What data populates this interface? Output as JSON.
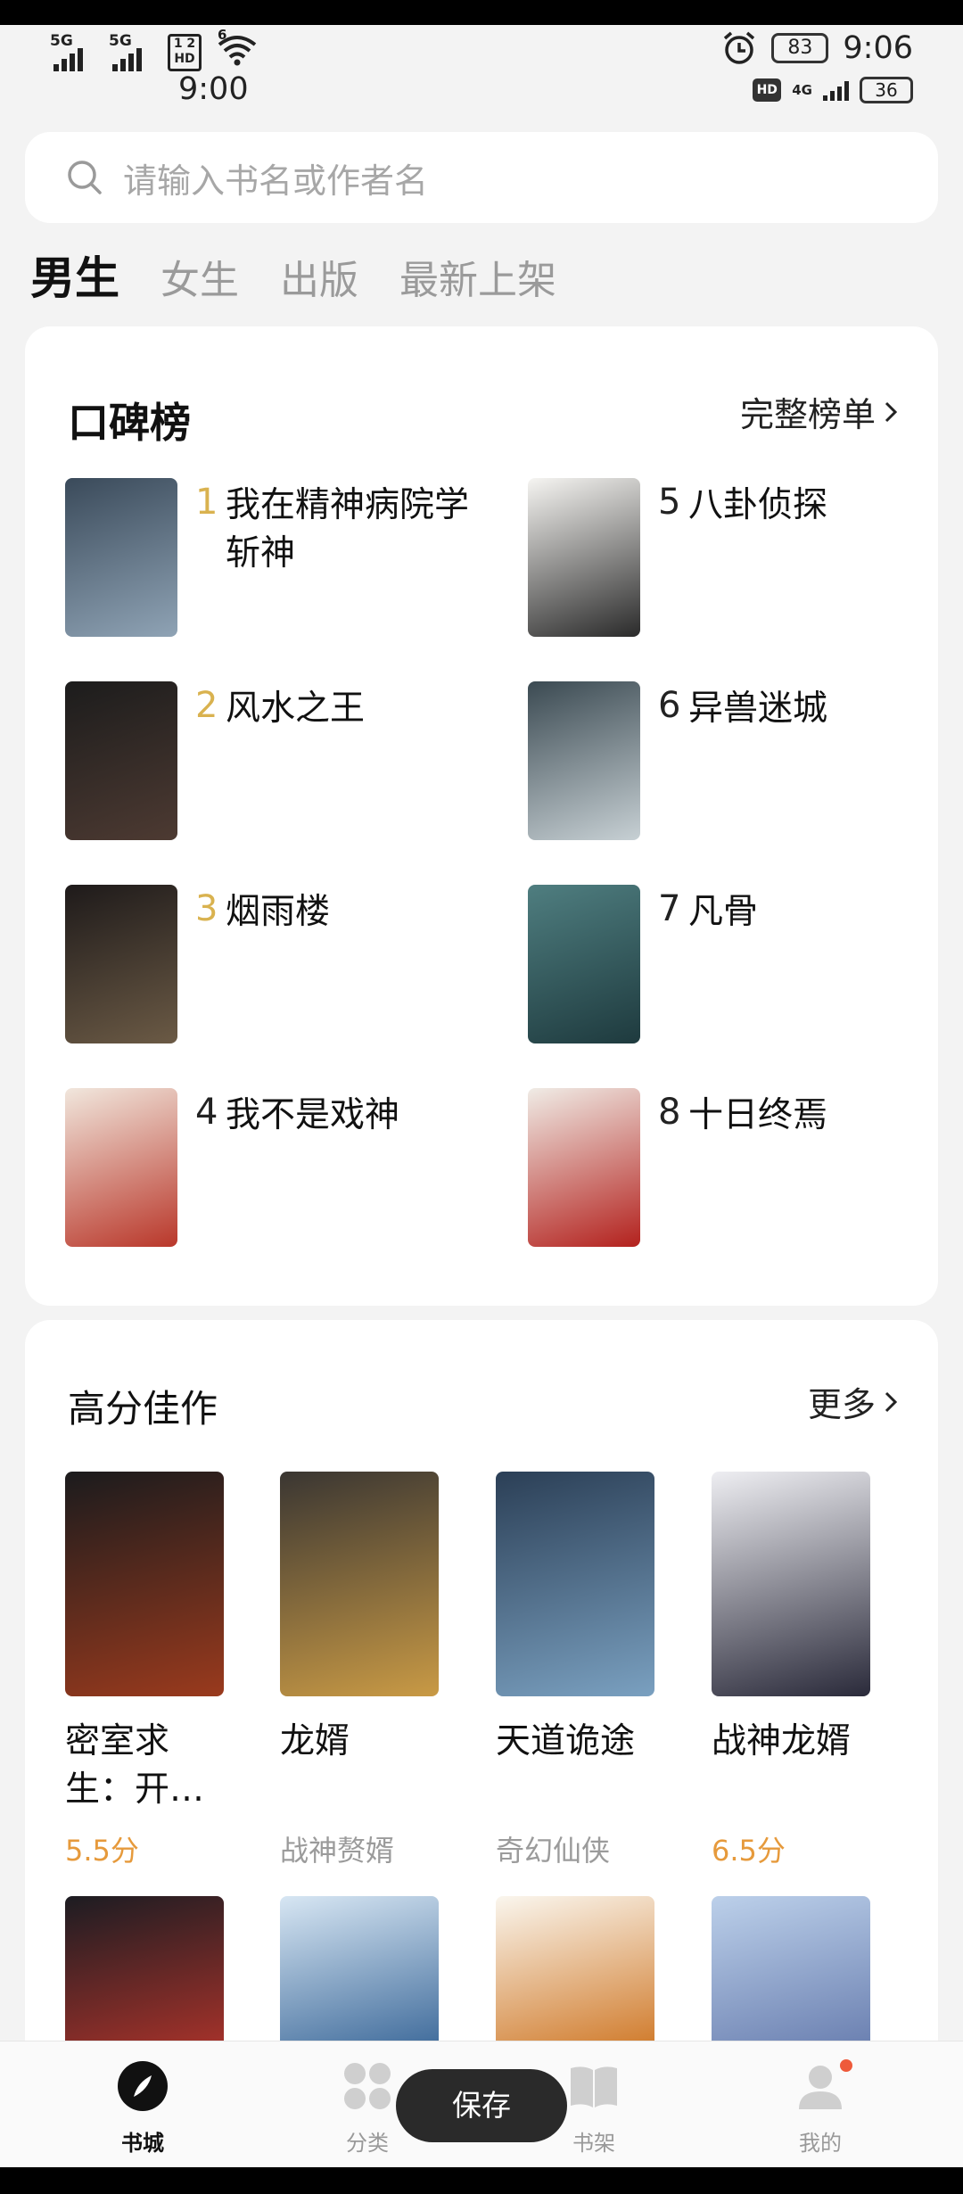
{
  "status": {
    "sim1": "5G",
    "sim2": "5G",
    "hd_label_top": "1 2",
    "hd_label_bottom": "HD",
    "wifi_label": "6",
    "time_left": "9:00",
    "battery_top": "83",
    "time_right": "9:06",
    "hd_small": "HD",
    "net": "4G",
    "battery_bottom": "36"
  },
  "search": {
    "placeholder": "请输入书名或作者名",
    "icon": "search-icon"
  },
  "tabs": [
    {
      "label": "男生",
      "active": true
    },
    {
      "label": "女生"
    },
    {
      "label": "出版"
    },
    {
      "label": "最新上架"
    }
  ],
  "ranking": {
    "title": "口碑榜",
    "more": "完整榜单",
    "items": [
      {
        "num": "1",
        "title": "我在精神病院学斩神",
        "cover": [
          "#3a4a5a",
          "#8fa3b5"
        ]
      },
      {
        "num": "2",
        "title": "风水之王",
        "cover": [
          "#1c1c1c",
          "#4d3a32"
        ]
      },
      {
        "num": "3",
        "title": "烟雨楼",
        "cover": [
          "#1e1a1a",
          "#6b5a45"
        ]
      },
      {
        "num": "4",
        "title": "我不是戏神",
        "cover": [
          "#f1e7dd",
          "#b9372a"
        ]
      },
      {
        "num": "5",
        "title": "八卦侦探",
        "cover": [
          "#f6f5f2",
          "#2a2a2a"
        ]
      },
      {
        "num": "6",
        "title": "异兽迷城",
        "cover": [
          "#3b4a52",
          "#c7d0d4"
        ]
      },
      {
        "num": "7",
        "title": "凡骨",
        "cover": [
          "#4f7e80",
          "#1e3a3e"
        ]
      },
      {
        "num": "8",
        "title": "十日终焉",
        "cover": [
          "#f0ece6",
          "#b3211d"
        ]
      }
    ]
  },
  "high_score": {
    "title": "高分佳作",
    "more": "更多",
    "items": [
      {
        "title": "密室求生：开…",
        "tag": "5.5分",
        "score": true,
        "cover": [
          "#1b1b1d",
          "#9a3a1d"
        ]
      },
      {
        "title": "龙婿",
        "tag": "战神赘婿",
        "score": false,
        "cover": [
          "#3a3632",
          "#c99a45"
        ]
      },
      {
        "title": "天道诡途",
        "tag": "奇幻仙侠",
        "score": false,
        "cover": [
          "#2b3f56",
          "#7aa0c0"
        ]
      },
      {
        "title": "战神龙婿",
        "tag": "6.5分",
        "score": true,
        "cover": [
          "#eeeef2",
          "#2a2a3a"
        ]
      }
    ],
    "row2": [
      {
        "cover": [
          "#1c1c22",
          "#a6322a"
        ]
      },
      {
        "cover": [
          "#d7e6f3",
          "#3f6b9b"
        ]
      },
      {
        "cover": [
          "#faf6ee",
          "#d07a2a"
        ]
      },
      {
        "cover": [
          "#bcd0ea",
          "#6a7fb0"
        ]
      }
    ]
  },
  "nav": [
    {
      "label": "书城",
      "icon": "bookstore-icon",
      "active": true
    },
    {
      "label": "分类",
      "icon": "category-icon"
    },
    {
      "label": "书架",
      "icon": "bookshelf-icon"
    },
    {
      "label": "我的",
      "icon": "profile-icon"
    }
  ],
  "toast": "保存"
}
